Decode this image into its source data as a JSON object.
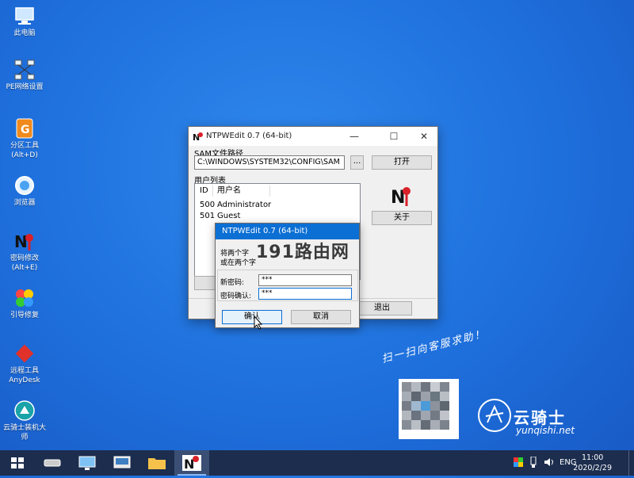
{
  "desktop": {
    "icons": [
      {
        "label": "此电脑",
        "icon": "computer-icon"
      },
      {
        "label": "PE网络设置",
        "icon": "network-icon"
      },
      {
        "label": "分区工具\n(Alt+D)",
        "icon": "partition-tool-icon"
      },
      {
        "label": "浏览器",
        "icon": "browser-icon"
      },
      {
        "label": "密码修改\n(Alt+E)",
        "icon": "password-edit-icon"
      },
      {
        "label": "引导修复",
        "icon": "boot-repair-icon"
      },
      {
        "label": "远程工具\nAnyDesk",
        "icon": "anydesk-icon"
      },
      {
        "label": "云骑士装机大\n师",
        "icon": "yunqishi-icon"
      }
    ],
    "watermark": "191路由网",
    "qr_caption": "扫一扫向客服求助！",
    "brand_name": "云骑士",
    "brand_url": "yunqishi.net"
  },
  "window": {
    "title": "NTPWEdit 0.7 (64-bit)",
    "minimize": "—",
    "maximize": "☐",
    "close": "✕",
    "sam_label": "SAM文件路径",
    "sam_path": "C:\\WINDOWS\\SYSTEM32\\CONFIG\\SAM",
    "browse_label": "...",
    "open_label": "打开",
    "user_list_label": "用户列表",
    "columns": [
      "ID",
      "用户名"
    ],
    "users": [
      {
        "id": "500",
        "name": "Administrator"
      },
      {
        "id": "501",
        "name": "Guest"
      }
    ],
    "about_label": "关于",
    "exit_label": "退出"
  },
  "dialog": {
    "title": "NTPWEdit 0.7 (64-bit)",
    "line1": "将两个字",
    "line2": "或在两个字",
    "new_pw_label": "新密码:",
    "new_pw_value": "***",
    "confirm_pw_label": "密码确认:",
    "confirm_pw_value": "***",
    "ok_label": "确认",
    "cancel_label": "取消"
  },
  "taskbar": {
    "lang": "ENG",
    "time": "11:00",
    "date": "2020/2/29"
  },
  "colors": {
    "desktop_bg": "#1e6fdc",
    "taskbar_bg": "#1c2d4e",
    "dialog_title": "#0b6fd4",
    "accent_red": "#d8212a"
  }
}
